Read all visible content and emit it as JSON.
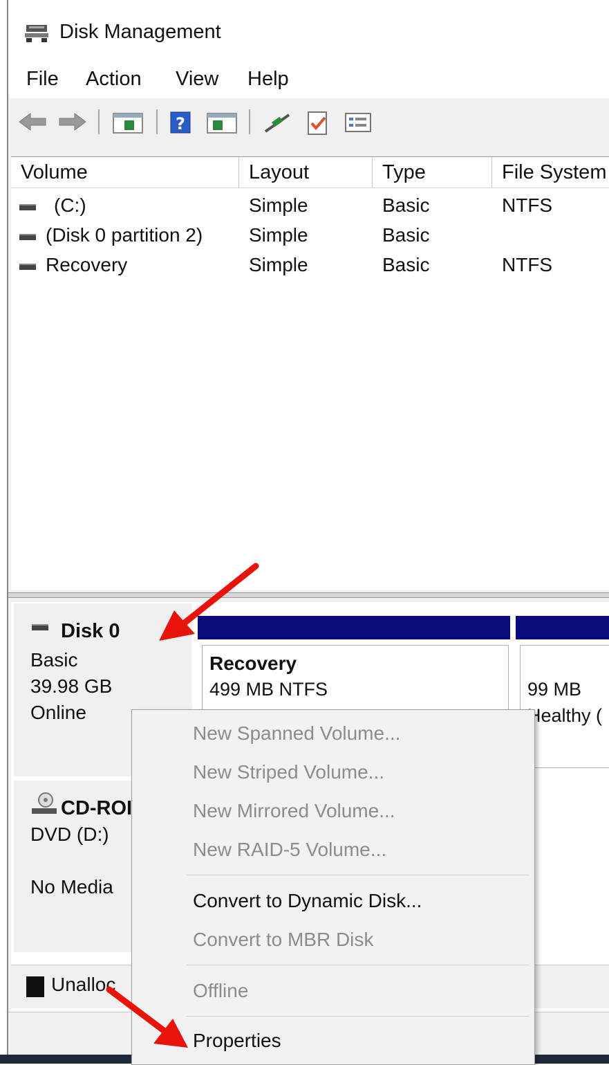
{
  "window": {
    "title": "Disk Management"
  },
  "menu": [
    "File",
    "Action",
    "View",
    "Help"
  ],
  "volume_list": {
    "columns": [
      "Volume",
      "Layout",
      "Type",
      "File System"
    ],
    "rows": [
      {
        "volume": "(C:)",
        "layout": "Simple",
        "type": "Basic",
        "fs": "NTFS"
      },
      {
        "volume": "(Disk 0 partition 2)",
        "layout": "Simple",
        "type": "Basic",
        "fs": ""
      },
      {
        "volume": "Recovery",
        "layout": "Simple",
        "type": "Basic",
        "fs": "NTFS"
      }
    ]
  },
  "disk0": {
    "name": "Disk 0",
    "type": "Basic",
    "size": "39.98 GB",
    "status": "Online",
    "partitions": [
      {
        "title": "Recovery",
        "line1": "499 MB NTFS"
      },
      {
        "title": "",
        "line1": "99 MB",
        "line2": "Healthy ("
      }
    ]
  },
  "cdrom": {
    "name": "CD-ROI",
    "drive": "DVD (D:)",
    "status": "No Media"
  },
  "legend": {
    "unallocated": "Unalloc"
  },
  "context_menu": {
    "items": [
      {
        "label": "New Spanned Volume...",
        "enabled": false
      },
      {
        "label": "New Striped Volume...",
        "enabled": false
      },
      {
        "label": "New Mirrored Volume...",
        "enabled": false
      },
      {
        "label": "New RAID-5 Volume...",
        "enabled": false
      },
      {
        "label": "Convert to Dynamic Disk...",
        "enabled": true
      },
      {
        "label": "Convert to MBR Disk",
        "enabled": false
      },
      {
        "label": "Offline",
        "enabled": false
      },
      {
        "label": "Properties",
        "enabled": true
      }
    ]
  },
  "colors": {
    "partition_header": "#0a0a7a",
    "annotation_arrow": "#e8140c",
    "disabled_text": "#8c8c8c"
  },
  "icons": [
    "disk-management-icon",
    "back-arrow-icon",
    "forward-arrow-icon",
    "console-tree-icon",
    "help-icon",
    "action-pane-icon",
    "connect-icon",
    "check-icon",
    "properties-list-icon",
    "disk-drive-icon",
    "cdrom-icon"
  ]
}
